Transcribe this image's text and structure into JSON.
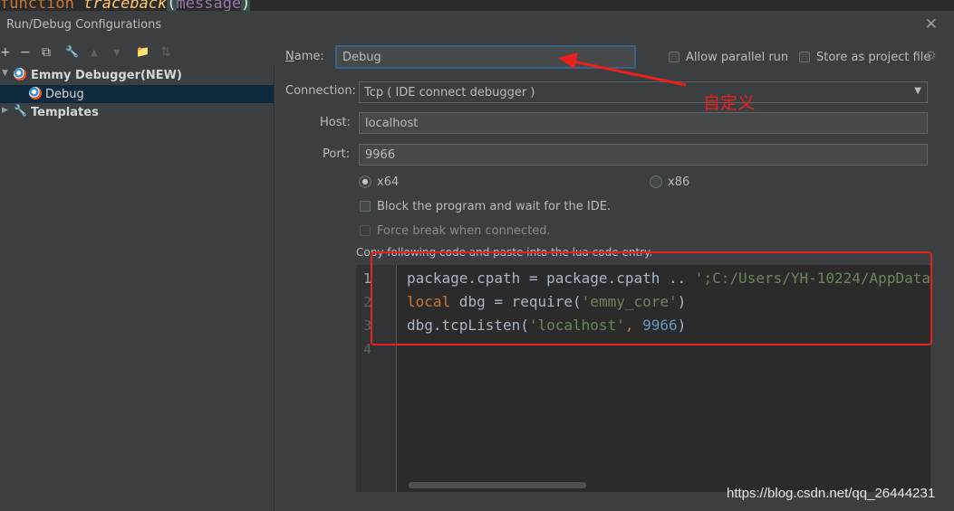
{
  "background_code": {
    "keyword": "function",
    "name": "traceback",
    "open_paren": "(",
    "arg": "message",
    "close_paren": ")"
  },
  "dialog": {
    "title": "Run/Debug Configurations",
    "close_glyph": "✕"
  },
  "toolbar": {
    "add": "+",
    "remove": "−",
    "copy": "⧉",
    "edit": "🔧",
    "up": "▲",
    "down": "▼",
    "folder": "📁",
    "sort": "⇅"
  },
  "tree": {
    "items": [
      {
        "label": "Emmy Debugger(NEW)",
        "expanded": true,
        "selected": false
      },
      {
        "label": "Debug",
        "selected": true
      },
      {
        "label": "Templates",
        "expanded": false,
        "selected": false
      }
    ]
  },
  "form": {
    "name_label": "Name:",
    "name_value": "Debug",
    "allow_parallel": "Allow parallel run",
    "store_project": "Store as project file",
    "connection_label": "Connection:",
    "connection_value": "Tcp ( IDE connect debugger )",
    "host_label": "Host:",
    "host_value": "localhost",
    "port_label": "Port:",
    "port_value": "9966",
    "arch_x64": "x64",
    "arch_x86": "x86",
    "arch_selected": "x64",
    "block_label": "Block the program and wait for the IDE.",
    "force_break_label": "Force break when connected.",
    "hint": "Copy following code and paste into the lua code entry."
  },
  "editor": {
    "line_numbers": [
      "1",
      "2",
      "3",
      "4"
    ],
    "line1": {
      "a": "package.cpath = package.cpath .. ",
      "b": "';C:/Users/YH-10224/AppData"
    },
    "line2": {
      "kw": "local",
      "a": " dbg = require(",
      "str": "'emmy_core'",
      "b": ")"
    },
    "line3": {
      "a": "dbg.tcpListen(",
      "str": "'localhost'",
      "comma": ", ",
      "num": "9966",
      "b": ")"
    }
  },
  "annotation": {
    "text": "自定义",
    "color": "#e82020"
  },
  "watermark": "https://blog.csdn.net/qq_26444231",
  "colors": {
    "background": "#3c3f41",
    "selection": "#0d293e",
    "keyword": "#cc7832",
    "string": "#6a8759",
    "number": "#6897bb",
    "highlight_box": "#e52222"
  }
}
